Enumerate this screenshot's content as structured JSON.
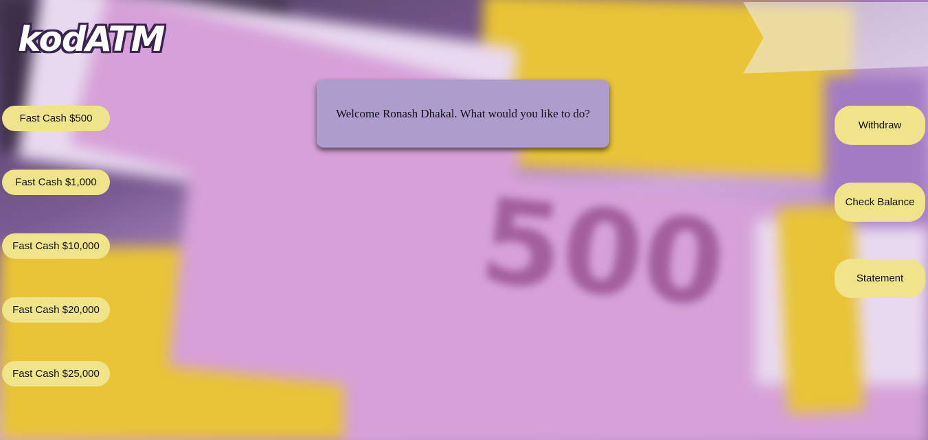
{
  "app": {
    "logo": "kodATM"
  },
  "welcome": {
    "message": "Welcome Ronash Dhakal. What would you like to do?"
  },
  "fast_cash": [
    {
      "label": "Fast Cash $500"
    },
    {
      "label": "Fast Cash $1,000"
    },
    {
      "label": "Fast Cash $10,000"
    },
    {
      "label": "Fast Cash $20,000"
    },
    {
      "label": "Fast Cash $25,000"
    }
  ],
  "actions": [
    {
      "label": "Withdraw"
    },
    {
      "label": "Check Balance"
    },
    {
      "label": "Statement"
    }
  ],
  "colors": {
    "button": "#f0e48a",
    "welcome_panel": "#ae9ccc",
    "logo_outline": "#3b2350"
  }
}
